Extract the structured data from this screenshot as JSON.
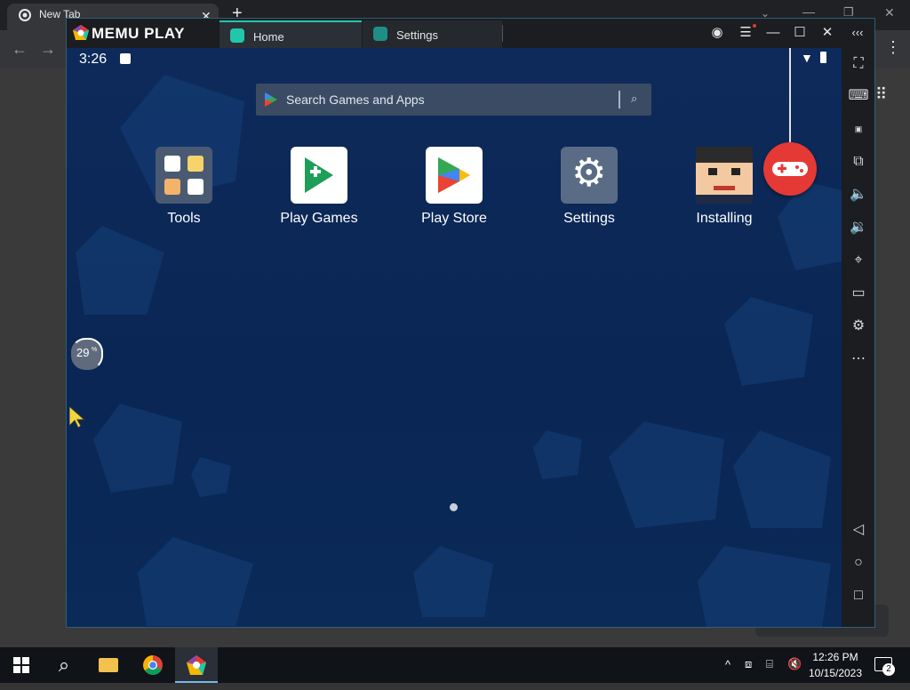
{
  "chrome": {
    "tab_title": "New Tab",
    "new_tab": "+"
  },
  "memu": {
    "brand": "MEMU PLAY",
    "tabs": [
      {
        "label": "Home"
      },
      {
        "label": "Settings"
      }
    ]
  },
  "android": {
    "time": "3:26",
    "search_placeholder": "Search Games and Apps",
    "apps": [
      {
        "label": "Tools"
      },
      {
        "label": "Play Games"
      },
      {
        "label": "Play Store"
      },
      {
        "label": "Settings"
      },
      {
        "label": "Installing"
      }
    ],
    "memory_badge": "29",
    "memory_unit": "%"
  },
  "taskbar": {
    "time": "12:26 PM",
    "date": "10/15/2023",
    "notification_count": "2"
  },
  "colors": {
    "accent": "#22c7a9",
    "android_bg": "#0b2a58",
    "gamepad": "#e53935"
  }
}
